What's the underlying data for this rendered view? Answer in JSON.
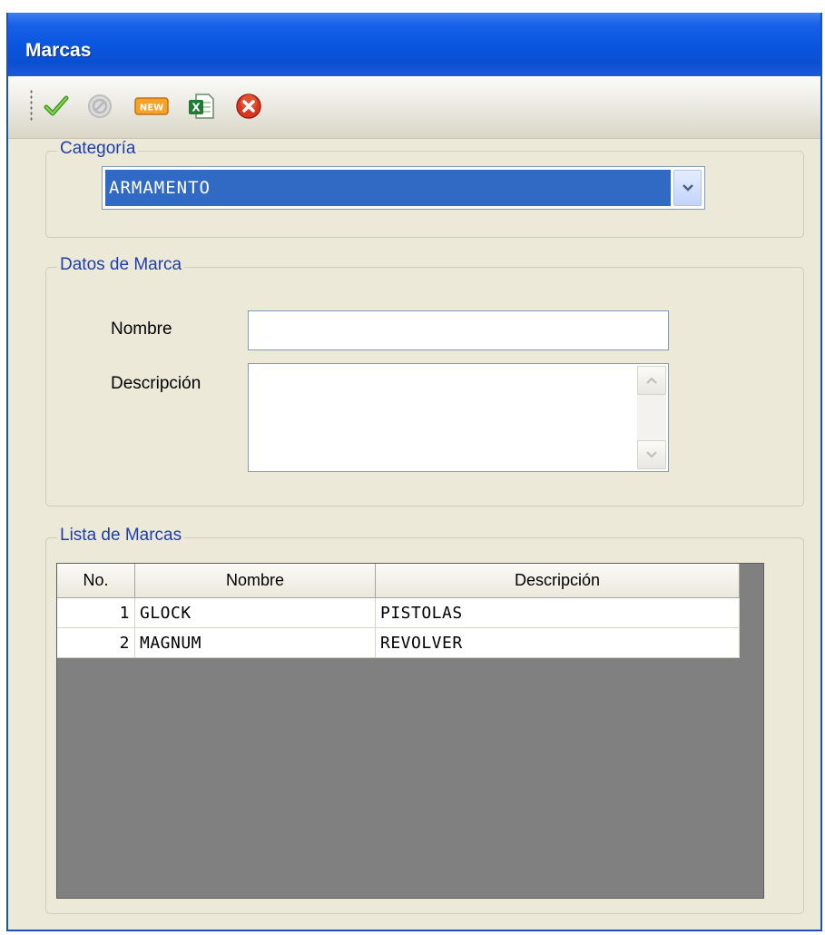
{
  "window": {
    "title": "Marcas"
  },
  "toolbar": {
    "buttons": [
      {
        "icon": "checkmark-icon",
        "name": "accept"
      },
      {
        "icon": "cancel-disabled-icon",
        "name": "cancel"
      },
      {
        "icon": "new-icon",
        "name": "new",
        "badge": "NEW"
      },
      {
        "icon": "excel-icon",
        "name": "excel",
        "badge": "X"
      },
      {
        "icon": "close-icon",
        "name": "close"
      }
    ]
  },
  "categoria": {
    "legend": "Categoría",
    "selected": "ARMAMENTO"
  },
  "datos": {
    "legend": "Datos de Marca",
    "nombre_label": "Nombre",
    "nombre_value": "",
    "descripcion_label": "Descripción",
    "descripcion_value": ""
  },
  "lista": {
    "legend": "Lista de Marcas",
    "columns": [
      "No.",
      "Nombre",
      "Descripción"
    ],
    "rows": [
      [
        "1",
        "GLOCK",
        "PISTOLAS"
      ],
      [
        "2",
        "MAGNUM",
        "REVOLVER"
      ]
    ]
  },
  "colors": {
    "title_bar": "#0a55dd",
    "selection": "#316ac5",
    "legend_text": "#1f3fa8",
    "grid_background": "#808080"
  }
}
